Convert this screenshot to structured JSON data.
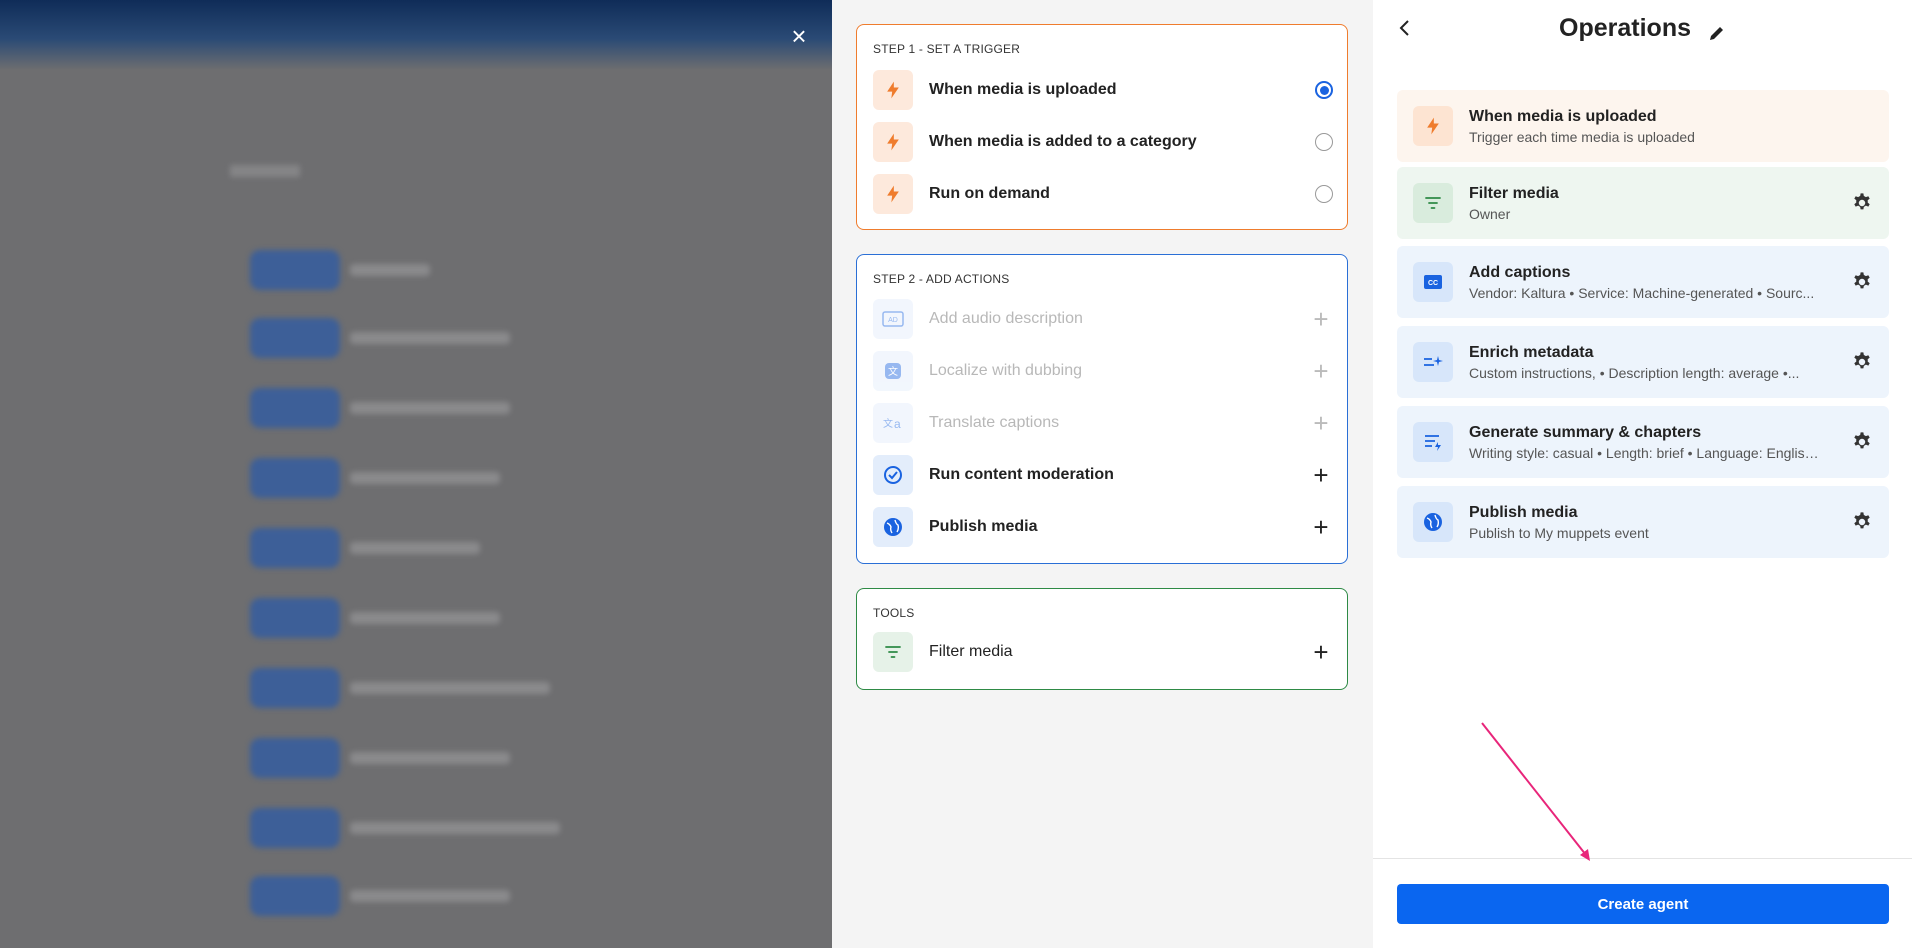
{
  "backdrop": {
    "close_label": "×"
  },
  "step1": {
    "title": "STEP 1 - SET A TRIGGER",
    "items": [
      {
        "label": "When media is uploaded",
        "selected": true,
        "icon": "bolt-icon"
      },
      {
        "label": "When media is added to a category",
        "selected": false,
        "icon": "bolt-icon"
      },
      {
        "label": "Run on demand",
        "selected": false,
        "icon": "bolt-icon"
      }
    ]
  },
  "step2": {
    "title": "STEP 2 - ADD ACTIONS",
    "items": [
      {
        "label": "Add audio description",
        "disabled": true,
        "icon": "audio-description-icon"
      },
      {
        "label": "Localize with dubbing",
        "disabled": true,
        "icon": "dubbing-icon"
      },
      {
        "label": "Translate captions",
        "disabled": true,
        "icon": "translate-icon"
      },
      {
        "label": "Run content moderation",
        "disabled": false,
        "icon": "check-circle-icon"
      },
      {
        "label": "Publish media",
        "disabled": false,
        "icon": "globe-icon"
      }
    ]
  },
  "tools": {
    "title": "TOOLS",
    "items": [
      {
        "label": "Filter media",
        "icon": "filter-icon"
      }
    ]
  },
  "operations": {
    "title": "Operations",
    "items": [
      {
        "name": "When media is uploaded",
        "sub": "Trigger each time media is uploaded",
        "icon": "bolt-icon",
        "bg": "#fdf5ee"
      },
      {
        "name": "Filter media",
        "sub": "Owner",
        "icon": "filter-icon",
        "bg": "#eef6f0"
      },
      {
        "name": "Add captions",
        "sub": "Vendor: Kaltura • Service: Machine-generated • Sourc...",
        "icon": "cc-icon",
        "bg": "#edf4fc"
      },
      {
        "name": "Enrich metadata",
        "sub": "Custom instructions, • Description length: average •...",
        "icon": "enrich-icon",
        "bg": "#edf4fc"
      },
      {
        "name": "Generate summary & chapters",
        "sub": "Writing style: casual • Length: brief • Language: English...",
        "icon": "summary-icon",
        "bg": "#edf4fc"
      },
      {
        "name": "Publish media",
        "sub": "Publish to My muppets event",
        "icon": "globe-icon",
        "bg": "#edf4fc"
      }
    ],
    "create_label": "Create agent"
  },
  "colors": {
    "accent": "#0a66f0",
    "trigger": "#ef7c2d",
    "tools": "#2e8a45",
    "annotation_arrow": "#e8257a"
  }
}
